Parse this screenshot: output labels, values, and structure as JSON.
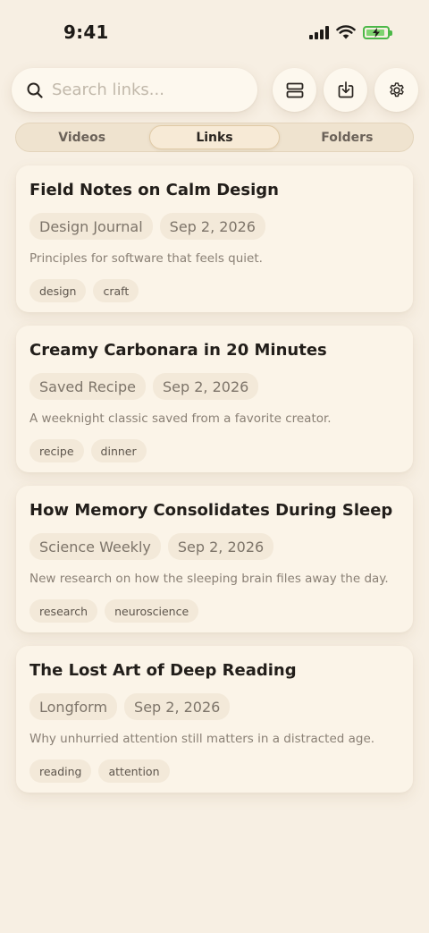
{
  "status": {
    "time": "9:41",
    "battery_color": "#4cb848"
  },
  "search": {
    "placeholder": "Search links...",
    "value": "",
    "icon": "search-icon"
  },
  "toolbar": {
    "buttons": [
      {
        "icon": "layout-rows-icon"
      },
      {
        "icon": "download-tray-icon"
      },
      {
        "icon": "gear-icon"
      }
    ]
  },
  "tabs": [
    {
      "label": "Videos",
      "active": false
    },
    {
      "label": "Links",
      "active": true
    },
    {
      "label": "Folders",
      "active": false
    }
  ],
  "links": [
    {
      "title": "Field Notes on Calm Design",
      "source": "Design Journal",
      "date": "Sep 2, 2026",
      "description": "Principles for software that feels quiet.",
      "tags": [
        "design",
        "craft"
      ]
    },
    {
      "title": "Creamy Carbonara in 20 Minutes",
      "source": "Saved Recipe",
      "date": "Sep 2, 2026",
      "description": "A weeknight classic saved from a favorite creator.",
      "tags": [
        "recipe",
        "dinner"
      ]
    },
    {
      "title": "How Memory Consolidates During Sleep",
      "source": "Science Weekly",
      "date": "Sep 2, 2026",
      "description": "New research on how the sleeping brain files away the day.",
      "tags": [
        "research",
        "neuroscience"
      ]
    },
    {
      "title": "The Lost Art of Deep Reading",
      "source": "Longform",
      "date": "Sep 2, 2026",
      "description": "Why unhurried attention still matters in a distracted age.",
      "tags": [
        "reading",
        "attention"
      ]
    }
  ],
  "colors": {
    "background": "#f7efe3",
    "card": "#fbf4e8",
    "pill": "#f3e9d9",
    "accent_tab": "#f7ead6"
  }
}
